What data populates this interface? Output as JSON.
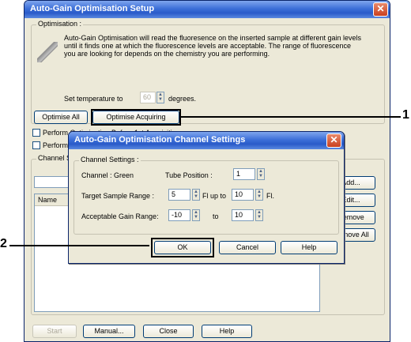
{
  "main_window": {
    "title": "Auto-Gain Optimisation Setup",
    "close_label": "✕",
    "optimisation_group_label": "Optimisation :",
    "description": "Auto-Gain Optimisation will read the fluoresence on the inserted sample at different gain levels until it finds one at which the fluorescence levels are acceptable. The range of fluorescence you are looking for depends on the chemistry you are performing.",
    "set_temp_label": "Set temperature to",
    "temperature_value": "60",
    "degrees_label": "degrees.",
    "optimise_all_label": "Optimise All",
    "optimise_acquiring_label": "Optimise Acquiring",
    "perform_option_1": "Perform Optimisation Before 1st Acquisition",
    "perform_option_2": "Perform",
    "channel_group_label": "Channel S",
    "list_header_name": "Name",
    "add_label": "Add...",
    "edit_label": "Edit...",
    "remove_label": "Remove",
    "remove_all_label": "Remove All",
    "start_label": "Start",
    "manual_label": "Manual...",
    "close_btn_label": "Close",
    "help_label": "Help"
  },
  "dialog": {
    "title": "Auto-Gain Optimisation Channel Settings",
    "close_label": "✕",
    "group_label": "Channel Settings :",
    "channel_label": "Channel :  Green",
    "tube_position_label": "Tube Position :",
    "tube_position_value": "1",
    "target_range_label": "Target Sample Range :",
    "target_from": "5",
    "fl_up_to_label": "Fl up to",
    "target_to": "10",
    "fl_label": "Fl.",
    "gain_range_label": "Acceptable Gain Range:",
    "gain_from": "-10",
    "to_label": "to",
    "gain_to": "10",
    "ok_label": "OK",
    "cancel_label": "Cancel",
    "help_label": "Help"
  },
  "callouts": {
    "one": "1",
    "two": "2"
  }
}
